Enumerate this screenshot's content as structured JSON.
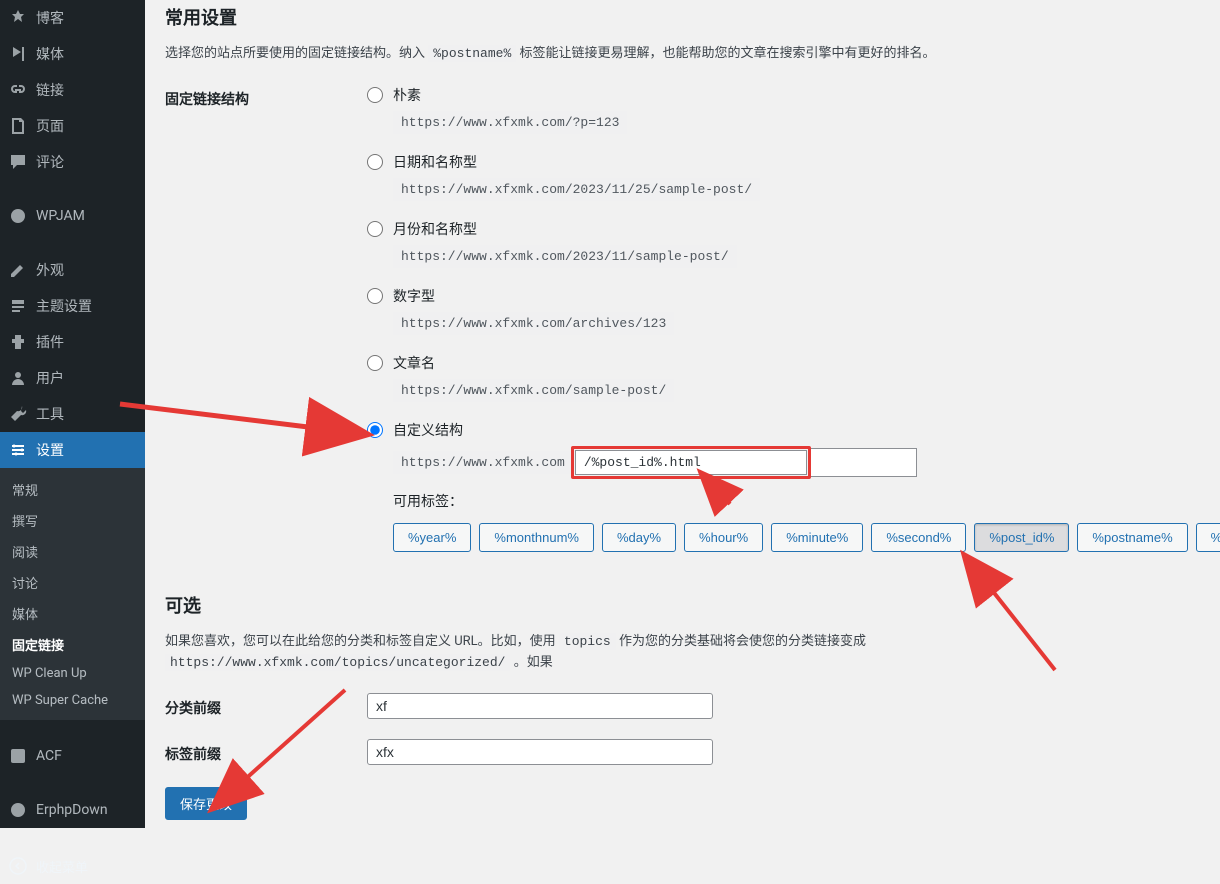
{
  "sidebar": {
    "items": [
      {
        "label": "博客",
        "icon": "pin"
      },
      {
        "label": "媒体",
        "icon": "media"
      },
      {
        "label": "链接",
        "icon": "link"
      },
      {
        "label": "页面",
        "icon": "page"
      },
      {
        "label": "评论",
        "icon": "comment"
      },
      {
        "label": "WPJAM",
        "icon": "generic"
      },
      {
        "label": "外观",
        "icon": "appearance"
      },
      {
        "label": "主题设置",
        "icon": "themesettings"
      },
      {
        "label": "插件",
        "icon": "plugin"
      },
      {
        "label": "用户",
        "icon": "user"
      },
      {
        "label": "工具",
        "icon": "tool"
      },
      {
        "label": "设置",
        "icon": "settings",
        "current": true
      },
      {
        "label": "ACF",
        "icon": "acf"
      },
      {
        "label": "ErphpDown",
        "icon": "erphp"
      }
    ],
    "submenu": [
      {
        "label": "常规"
      },
      {
        "label": "撰写"
      },
      {
        "label": "阅读"
      },
      {
        "label": "讨论"
      },
      {
        "label": "媒体"
      },
      {
        "label": "固定链接",
        "active": true
      },
      {
        "label": "WP Clean Up"
      },
      {
        "label": "WP Super Cache"
      }
    ],
    "collapse_label": "收起菜单"
  },
  "content": {
    "section1_title": "常用设置",
    "section1_desc_prefix": "选择您的站点所要使用的固定链接结构。纳入 ",
    "section1_desc_tag": "%postname%",
    "section1_desc_suffix": " 标签能让链接更易理解，也能帮助您的文章在搜索引擎中有更好的排名。",
    "permalink_label": "固定链接结构",
    "radios": [
      {
        "label": "朴素",
        "code": "https://www.xfxmk.com/?p=123"
      },
      {
        "label": "日期和名称型",
        "code": "https://www.xfxmk.com/2023/11/25/sample-post/"
      },
      {
        "label": "月份和名称型",
        "code": "https://www.xfxmk.com/2023/11/sample-post/"
      },
      {
        "label": "数字型",
        "code": "https://www.xfxmk.com/archives/123"
      },
      {
        "label": "文章名",
        "code": "https://www.xfxmk.com/sample-post/"
      }
    ],
    "custom_radio_label": "自定义结构",
    "custom_prefix": "https://www.xfxmk.com",
    "custom_value": "/%post_id%.html",
    "tags_label": "可用标签：",
    "tags": [
      "%year%",
      "%monthnum%",
      "%day%",
      "%hour%",
      "%minute%",
      "%second%",
      "%post_id%",
      "%postname%",
      "%category%"
    ],
    "active_tag_index": 6,
    "section2_title": "可选",
    "section2_desc_prefix": "如果您喜欢，您可以在此给您的分类和标签自定义 URL。比如，使用 ",
    "section2_desc_tag": "topics",
    "section2_desc_mid": " 作为您的分类基础将会使您的分类链接变成 ",
    "section2_desc_code": "https://www.xfxmk.com/topics/uncategorized/",
    "section2_desc_suffix": " 。如果",
    "category_label": "分类前缀",
    "category_value": "xf",
    "tag_label": "标签前缀",
    "tag_value": "xfx",
    "save_label": "保存更改"
  }
}
